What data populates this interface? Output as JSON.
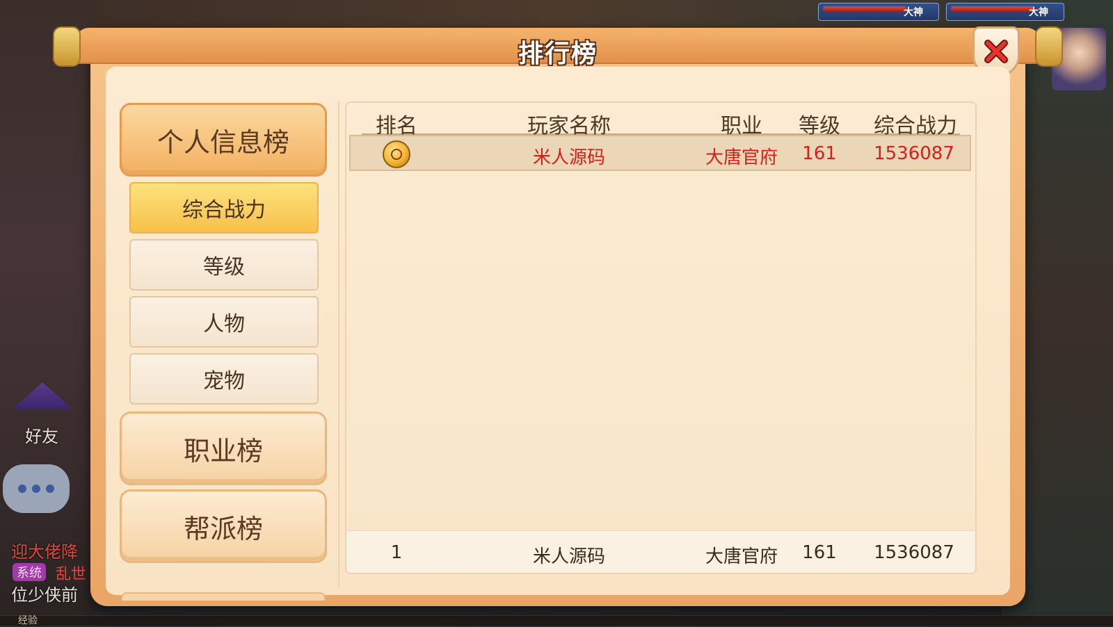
{
  "background": {
    "hud_left_tag": "大神",
    "hud_right_tag": "大神",
    "friend_label": "好友",
    "chat_line_red": "迎大佬降",
    "system_badge": "系统",
    "system_text": "乱世",
    "chat_line_white": "位少侠前",
    "exp_label": "经验"
  },
  "window": {
    "title": "排行榜"
  },
  "menu": {
    "personal": "个人信息榜",
    "sub_items": [
      {
        "label": "综合战力"
      },
      {
        "label": "等级"
      },
      {
        "label": "人物"
      },
      {
        "label": "宠物"
      }
    ],
    "profession": "职业榜",
    "guild": "帮派榜"
  },
  "table": {
    "headers": [
      "排名",
      "玩家名称",
      "职业",
      "等级",
      "综合战力"
    ],
    "rows": [
      {
        "rank_icon": "gold-medal-icon",
        "name": "米人源码",
        "profession": "大唐官府",
        "level": "161",
        "power": "1536087"
      }
    ],
    "my_row": {
      "rank": "1",
      "name": "米人源码",
      "profession": "大唐官府",
      "level": "161",
      "power": "1536087"
    }
  },
  "colors": {
    "accent_orange": "#f0b376",
    "active_yellow": "#f6c04a",
    "highlight_red": "#d61f1a"
  }
}
